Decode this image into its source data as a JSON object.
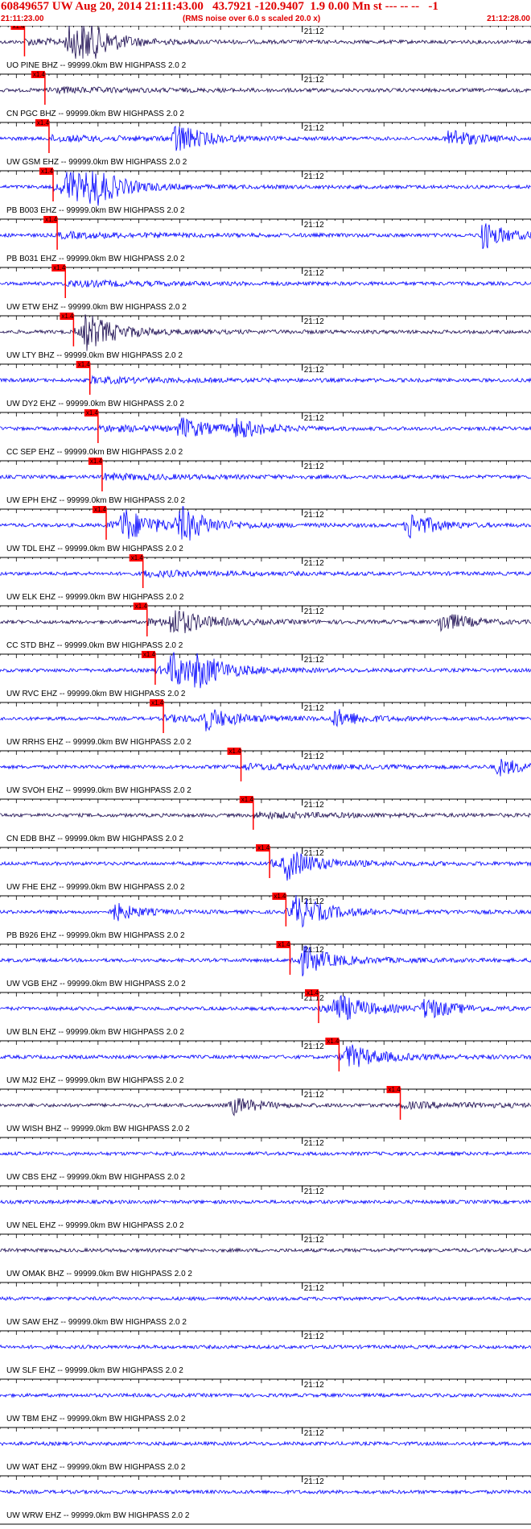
{
  "header": {
    "title": "60849657 UW Aug 20, 2014 21:11:43.00   43.7921 -120.9407  1.9 0.00 Mn st --- -- --   -1",
    "start_time": "21:11:23.00",
    "note": "(RMS noise over 6.0 s scaled 20.0 x)",
    "end_time": "21:12:28.00"
  },
  "chart_data": {
    "type": "line",
    "x_range": [
      "21:11:23.00",
      "21:12:28.00"
    ],
    "minute_label": "21:12",
    "pick_label": "x1.4",
    "colors": {
      "pick": "#ff0000",
      "axis": "#000000",
      "wave_blue": "#0000ff",
      "wave_dark": "#1a0a50"
    },
    "traces": [
      {
        "label": "UO PINE BHZ -- 99999.0km BW  HIGHPASS  2.0  2",
        "color": "dark",
        "pick_time": "21:11:26.0",
        "bursts": [
          {
            "t": "21:11:31.5",
            "amp": 1.0
          },
          {
            "t": "21:11:33.0",
            "amp": 0.8
          }
        ]
      },
      {
        "label": "CN PGC BHZ -- 99999.0km BW  HIGHPASS  2.0  2",
        "color": "dark",
        "pick_time": "21:11:28.5",
        "bursts": []
      },
      {
        "label": "UW GSM EHZ -- 99999.0km BW  HIGHPASS  2.0  2",
        "color": "blue",
        "pick_time": "21:11:29.0",
        "bursts": [
          {
            "t": "21:11:44.5",
            "amp": 0.9
          },
          {
            "t": "21:12:18.0",
            "amp": 0.6
          }
        ]
      },
      {
        "label": "PB B003 EHZ -- 99999.0km BW  HIGHPASS  2.0  2",
        "color": "blue",
        "pick_time": "21:11:29.5",
        "bursts": [
          {
            "t": "21:11:31.0",
            "amp": 1.0
          },
          {
            "t": "21:11:34.0",
            "amp": 0.9
          }
        ]
      },
      {
        "label": "PB B031 EHZ -- 99999.0km BW  HIGHPASS  2.0  2",
        "color": "blue",
        "pick_time": "21:11:30.0",
        "bursts": [
          {
            "t": "21:12:22.0",
            "amp": 0.8
          }
        ]
      },
      {
        "label": "UW ETW EHZ -- 99999.0km BW  HIGHPASS  2.0  2",
        "color": "blue",
        "pick_time": "21:11:31.0",
        "bursts": []
      },
      {
        "label": "UW LTY BHZ -- 99999.0km BW  HIGHPASS  2.0  2",
        "color": "dark",
        "pick_time": "21:11:32.0",
        "bursts": [
          {
            "t": "21:11:33.5",
            "amp": 1.0
          }
        ]
      },
      {
        "label": "UW DY2 EHZ -- 99999.0km BW  HIGHPASS  2.0  2",
        "color": "blue",
        "pick_time": "21:11:34.0",
        "bursts": []
      },
      {
        "label": "CC SEP EHZ -- 99999.0km BW  HIGHPASS  2.0  2",
        "color": "blue",
        "pick_time": "21:11:35.0",
        "bursts": [
          {
            "t": "21:11:45.0",
            "amp": 0.6
          },
          {
            "t": "21:11:52.0",
            "amp": 0.55
          }
        ]
      },
      {
        "label": "UW EPH EHZ -- 99999.0km BW  HIGHPASS  2.0  2",
        "color": "blue",
        "pick_time": "21:11:35.5",
        "bursts": []
      },
      {
        "label": "UW TDL EHZ -- 99999.0km BW  HIGHPASS  2.0  2",
        "color": "blue",
        "pick_time": "21:11:36.0",
        "bursts": [
          {
            "t": "21:11:38.0",
            "amp": 0.9
          },
          {
            "t": "21:11:45.0",
            "amp": 1.0
          },
          {
            "t": "21:12:13.0",
            "amp": 0.8
          }
        ]
      },
      {
        "label": "UW ELK EHZ -- 99999.0km BW  HIGHPASS  2.0  2",
        "color": "blue",
        "pick_time": "21:11:40.5",
        "bursts": []
      },
      {
        "label": "CC STD BHZ -- 99999.0km BW  HIGHPASS  2.0  2",
        "color": "dark",
        "pick_time": "21:11:41.0",
        "bursts": [
          {
            "t": "21:11:44.0",
            "amp": 0.8
          },
          {
            "t": "21:12:17.0",
            "amp": 0.6
          }
        ]
      },
      {
        "label": "UW RVC EHZ -- 99999.0km BW  HIGHPASS  2.0  2",
        "color": "blue",
        "pick_time": "21:11:42.0",
        "bursts": [
          {
            "t": "21:11:44.0",
            "amp": 1.0
          },
          {
            "t": "21:11:47.0",
            "amp": 0.7
          }
        ]
      },
      {
        "label": "UW RRHS EHZ -- 99999.0km BW  HIGHPASS  2.0  2",
        "color": "blue",
        "pick_time": "21:11:43.0",
        "bursts": [
          {
            "t": "21:11:48.0",
            "amp": 0.6
          },
          {
            "t": "21:12:04.0",
            "amp": 0.5
          }
        ]
      },
      {
        "label": "UW SVOH EHZ -- 99999.0km BW  HIGHPASS  2.0  2",
        "color": "blue",
        "pick_time": "21:11:52.5",
        "bursts": [
          {
            "t": "21:12:24.0",
            "amp": 0.5
          }
        ]
      },
      {
        "label": "CN EDB BHZ -- 99999.0km BW  HIGHPASS  2.0  2",
        "color": "dark",
        "pick_time": "21:11:54.0",
        "bursts": []
      },
      {
        "label": "UW FHE EHZ -- 99999.0km BW  HIGHPASS  2.0  2",
        "color": "blue",
        "pick_time": "21:11:56.0",
        "bursts": [
          {
            "t": "21:11:58.0",
            "amp": 0.8
          }
        ]
      },
      {
        "label": "PB B926 EHZ -- 99999.0km BW  HIGHPASS  2.0  2",
        "color": "blue",
        "pick_time": "21:11:58.0",
        "bursts": [
          {
            "t": "21:11:59.0",
            "amp": 0.9
          },
          {
            "t": "21:11:37.0",
            "amp": 0.5
          }
        ]
      },
      {
        "label": "UW VGB EHZ -- 99999.0km BW  HIGHPASS  2.0  2",
        "color": "blue",
        "pick_time": "21:11:58.5",
        "bursts": [
          {
            "t": "21:12:00.0",
            "amp": 0.7
          }
        ]
      },
      {
        "label": "UW BLN EHZ -- 99999.0km BW  HIGHPASS  2.0  2",
        "color": "blue",
        "pick_time": "21:12:02.0",
        "bursts": [
          {
            "t": "21:12:04.0",
            "amp": 0.8
          },
          {
            "t": "21:12:15.0",
            "amp": 0.6
          }
        ]
      },
      {
        "label": "UW MJ2 EHZ -- 99999.0km BW  HIGHPASS  2.0  2",
        "color": "blue",
        "pick_time": "21:12:04.5",
        "bursts": [
          {
            "t": "21:12:05.5",
            "amp": 0.6
          }
        ]
      },
      {
        "label": "UW WISH BHZ -- 99999.0km BW  HIGHPASS  2.0  2",
        "color": "dark",
        "pick_time": "21:12:12.0",
        "bursts": [
          {
            "t": "21:11:51.5",
            "amp": 0.5
          }
        ]
      },
      {
        "label": "UW CBS EHZ -- 99999.0km BW  HIGHPASS  2.0  2",
        "color": "blue",
        "pick_time": null,
        "bursts": []
      },
      {
        "label": "UW NEL EHZ -- 99999.0km BW  HIGHPASS  2.0  2",
        "color": "blue",
        "pick_time": null,
        "bursts": []
      },
      {
        "label": "UW OMAK BHZ -- 99999.0km BW  HIGHPASS  2.0  2",
        "color": "dark",
        "pick_time": null,
        "bursts": []
      },
      {
        "label": "UW SAW EHZ -- 99999.0km BW  HIGHPASS  2.0  2",
        "color": "blue",
        "pick_time": null,
        "bursts": []
      },
      {
        "label": "UW SLF EHZ -- 99999.0km BW  HIGHPASS  2.0  2",
        "color": "blue",
        "pick_time": null,
        "bursts": []
      },
      {
        "label": "UW TBM EHZ -- 99999.0km BW  HIGHPASS  2.0  2",
        "color": "blue",
        "pick_time": null,
        "bursts": []
      },
      {
        "label": "UW WAT EHZ -- 99999.0km BW  HIGHPASS  2.0  2",
        "color": "blue",
        "pick_time": null,
        "bursts": []
      },
      {
        "label": "UW WRW EHZ -- 99999.0km BW  HIGHPASS  2.0  2",
        "color": "blue",
        "pick_time": null,
        "bursts": []
      }
    ]
  }
}
